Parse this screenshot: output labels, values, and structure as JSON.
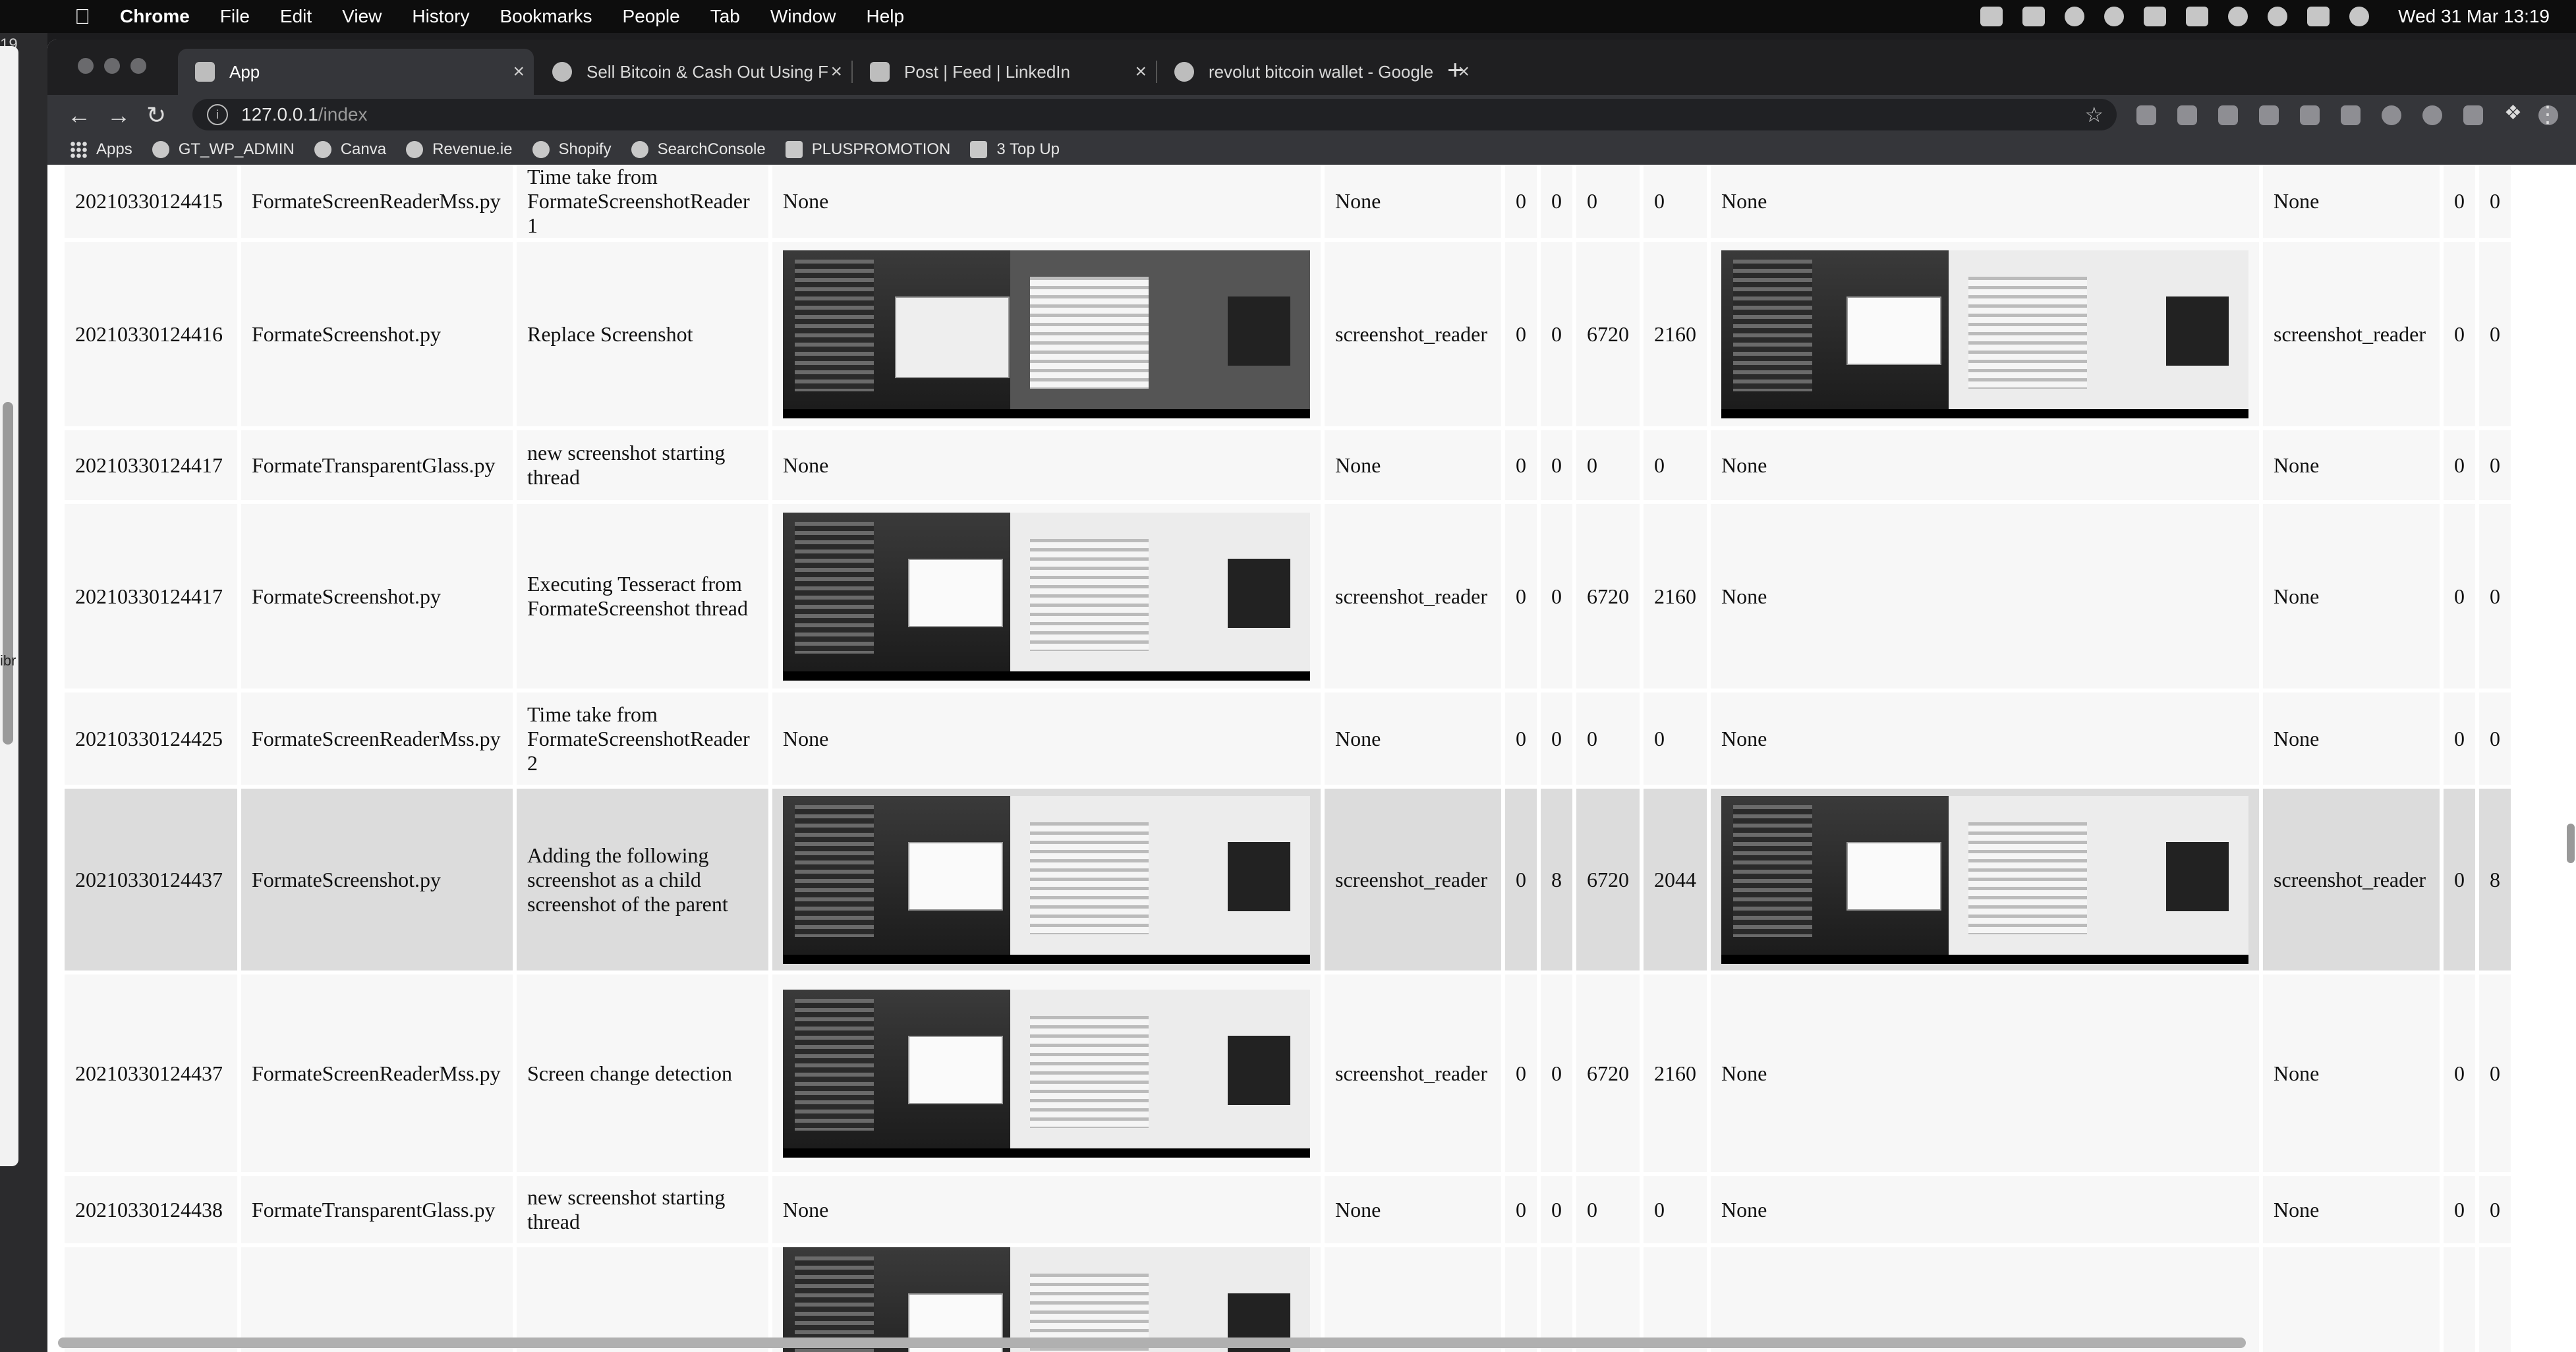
{
  "menubar": {
    "app": "Chrome",
    "items": [
      "File",
      "Edit",
      "View",
      "History",
      "Bookmarks",
      "People",
      "Tab",
      "Window",
      "Help"
    ],
    "clock": "Wed 31 Mar  13:19"
  },
  "leftstrip": {
    "num": "19",
    "label": "ibr"
  },
  "tabs": [
    {
      "title": "App"
    },
    {
      "title": "Sell Bitcoin & Cash Out Using F"
    },
    {
      "title": "Post | Feed | LinkedIn"
    },
    {
      "title": "revolut bitcoin wallet - Google"
    }
  ],
  "omnibox": {
    "host": "127.0.0.1",
    "path": "/index"
  },
  "bookmarks": [
    "Apps",
    "GT_WP_ADMIN",
    "Canva",
    "Revenue.ie",
    "Shopify",
    "SearchConsole",
    "PLUSPROMOTION",
    "3 Top Up"
  ],
  "rows": [
    {
      "id": "20210330124415",
      "file": "FormateScreenReaderMss.py",
      "msg": "Time take from FormateScreenshotReader 1",
      "img1": "None",
      "src1": "None",
      "a": "0",
      "b": "0",
      "w": "0",
      "h": "0",
      "img2": "None",
      "src2": "None",
      "c": "0",
      "d": "0"
    },
    {
      "id": "20210330124416",
      "file": "FormateScreenshot.py",
      "msg": "Replace Screenshot",
      "src1": "screenshot_reader",
      "a": "0",
      "b": "0",
      "w": "6720",
      "h": "2160",
      "src2": "screenshot_reader",
      "c": "0",
      "d": "0"
    },
    {
      "id": "20210330124417",
      "file": "FormateTransparentGlass.py",
      "msg": "new screenshot starting thread",
      "img1": "None",
      "src1": "None",
      "a": "0",
      "b": "0",
      "w": "0",
      "h": "0",
      "img2": "None",
      "src2": "None",
      "c": "0",
      "d": "0"
    },
    {
      "id": "20210330124417",
      "file": "FormateScreenshot.py",
      "msg": "Executing Tesseract from FormateScreenshot thread",
      "src1": "screenshot_reader",
      "a": "0",
      "b": "0",
      "w": "6720",
      "h": "2160",
      "img2": "None",
      "src2": "None",
      "c": "0",
      "d": "0"
    },
    {
      "id": "20210330124425",
      "file": "FormateScreenReaderMss.py",
      "msg": "Time take from FormateScreenshotReader 2",
      "img1": "None",
      "src1": "None",
      "a": "0",
      "b": "0",
      "w": "0",
      "h": "0",
      "img2": "None",
      "src2": "None",
      "c": "0",
      "d": "0"
    },
    {
      "id": "20210330124437",
      "file": "FormateScreenshot.py",
      "msg": "Adding the following screenshot as a child screenshot of the parent",
      "src1": "screenshot_reader",
      "a": "0",
      "b": "8",
      "w": "6720",
      "h": "2044",
      "src2": "screenshot_reader",
      "c": "0",
      "d": "8"
    },
    {
      "id": "20210330124437",
      "file": "FormateScreenReaderMss.py",
      "msg": "Screen change detection",
      "src1": "screenshot_reader",
      "a": "0",
      "b": "0",
      "w": "6720",
      "h": "2160",
      "img2": "None",
      "src2": "None",
      "c": "0",
      "d": "0"
    },
    {
      "id": "20210330124438",
      "file": "FormateTransparentGlass.py",
      "msg": "new screenshot starting thread",
      "img1": "None",
      "src1": "None",
      "a": "0",
      "b": "0",
      "w": "0",
      "h": "0",
      "img2": "None",
      "src2": "None",
      "c": "0",
      "d": "0"
    }
  ]
}
